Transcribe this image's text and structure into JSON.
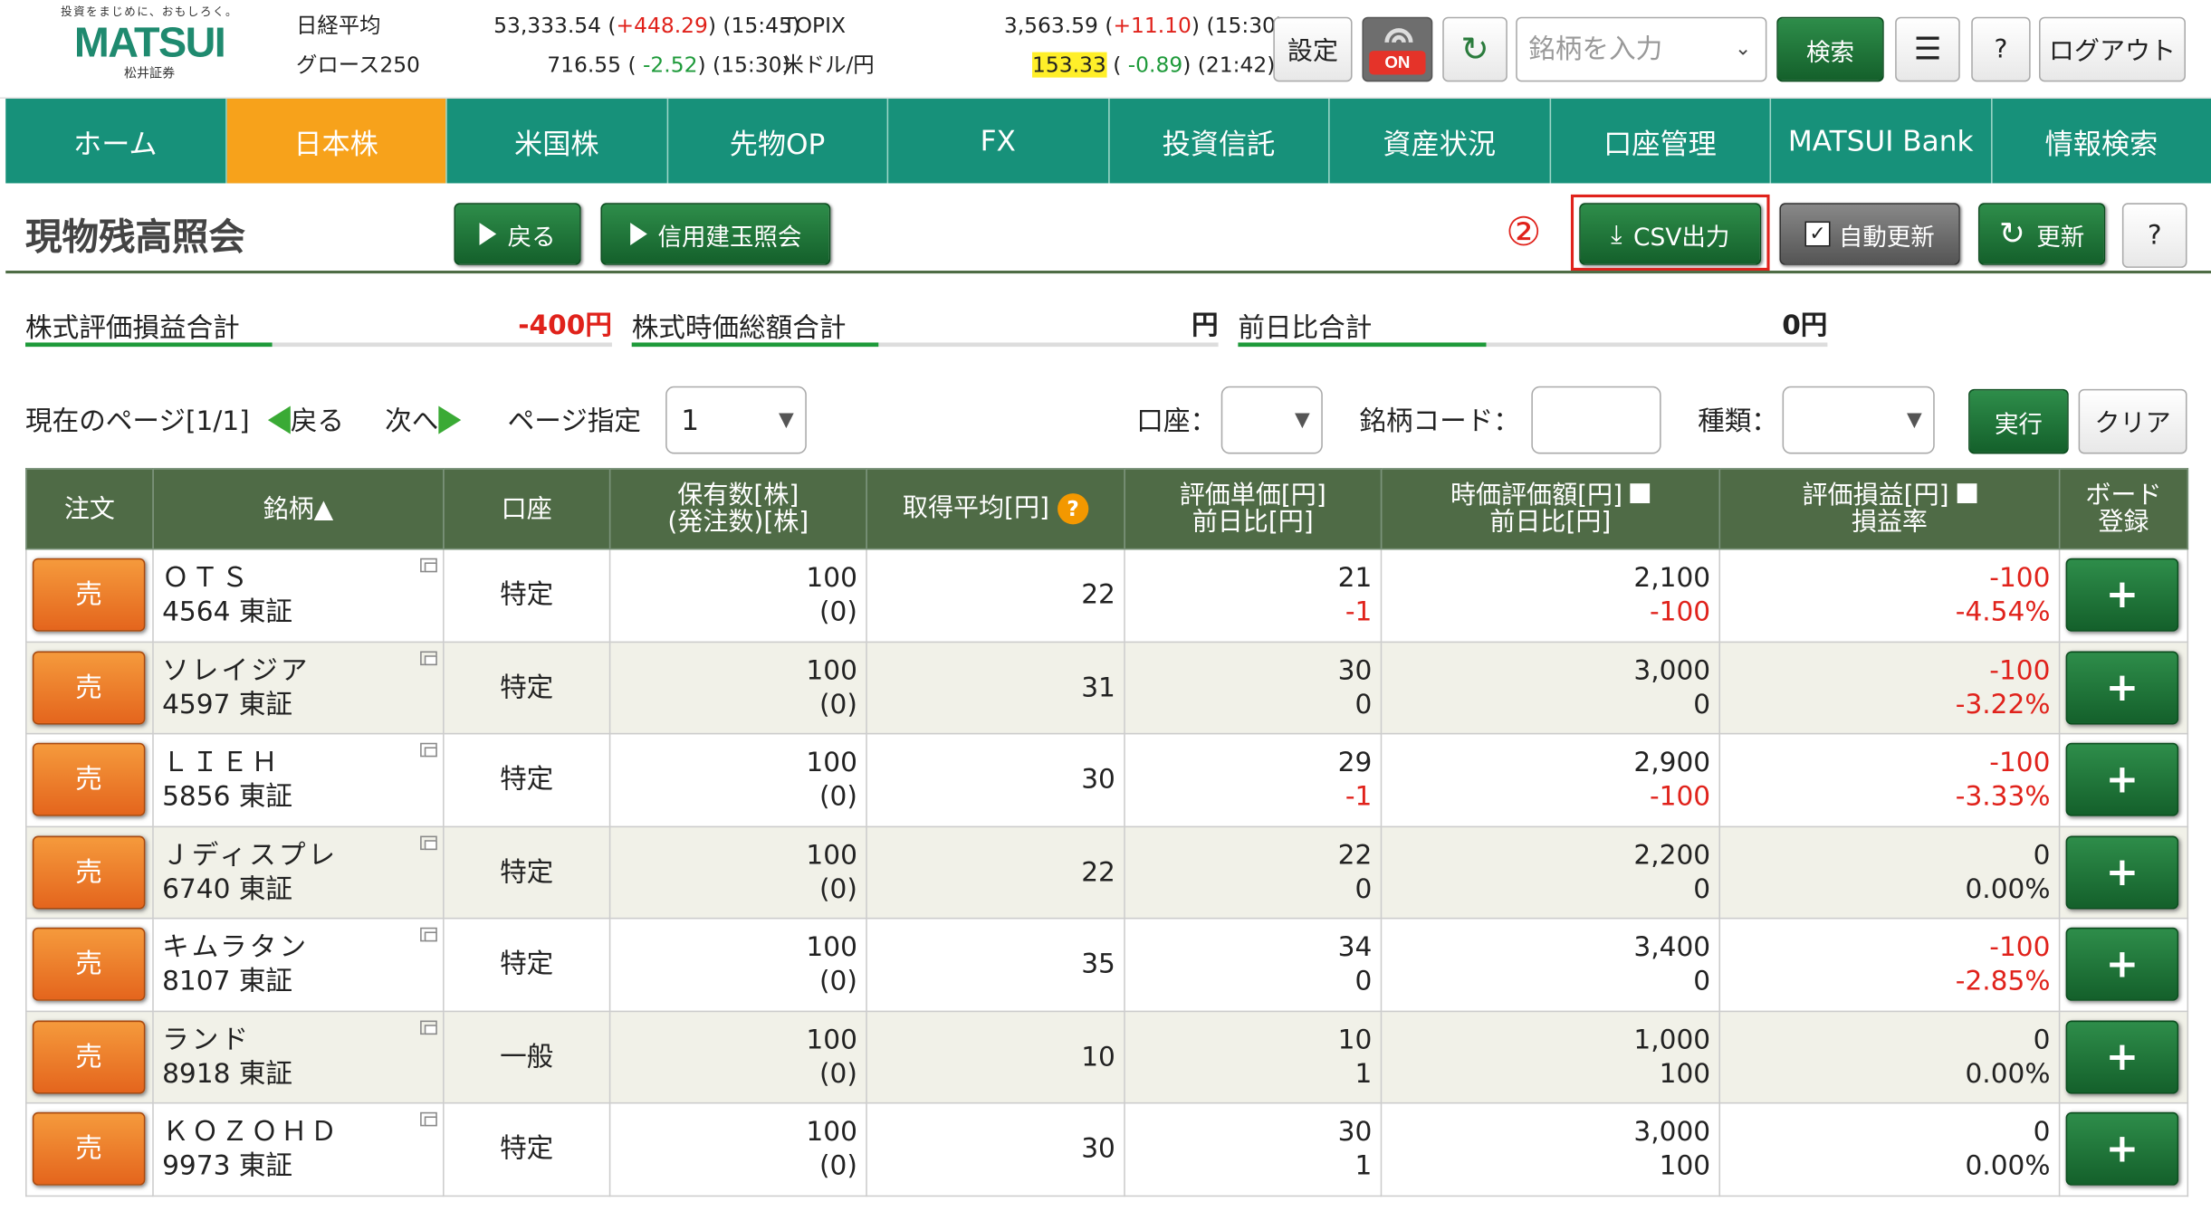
{
  "logo": {
    "tagline": "投資をまじめに、おもしろく。",
    "name": "MATSUI",
    "sub": "松井証券"
  },
  "market": {
    "nikkei": {
      "label": "日経平均",
      "value": "53,333.54",
      "open": " (",
      "change": "+448.29",
      "close": ")",
      "time": "(15:45)"
    },
    "topix": {
      "label": "TOPIX",
      "value": "3,563.59",
      "open": " (",
      "change": "+11.10",
      "close": ")",
      "time": "(15:30)"
    },
    "growth": {
      "label": "グロース250",
      "value": "716.55",
      "open": " ( ",
      "change": "-2.52",
      "close": ")",
      "time": "(15:30)"
    },
    "usdjpy": {
      "label": "米ドル/円",
      "value": "153.33",
      "open": " ( ",
      "change": "-0.89",
      "close": ")",
      "time": "(21:42)"
    }
  },
  "toolbar": {
    "settings": "設定",
    "wifi_status": "ON",
    "search_placeholder": "銘柄を入力",
    "search_button": "検索",
    "help": "?",
    "logout": "ログアウト"
  },
  "nav": [
    "ホーム",
    "日本株",
    "米国株",
    "先物OP",
    "FX",
    "投資信託",
    "資産状況",
    "口座管理",
    "MATSUI Bank",
    "情報検索"
  ],
  "nav_active": "日本株",
  "page": {
    "title": "現物残高照会",
    "back": "戻る",
    "margin": "信用建玉照会",
    "step": "②",
    "csv": "CSV出力",
    "auto_update": "自動更新",
    "refresh": "更新",
    "help": "?"
  },
  "summary": [
    {
      "label": "株式評価損益合計",
      "value": "-400円"
    },
    {
      "label": "株式時価総額合計",
      "value": "円"
    },
    {
      "label": "前日比合計",
      "value": "0円"
    }
  ],
  "pager": {
    "current": "現在のページ[1/1]",
    "prev": "戻る",
    "next": "次へ",
    "page_label": "ページ指定",
    "page_value": "1",
    "account_label": "口座：",
    "code_label": "銘柄コード：",
    "type_label": "種類：",
    "execute": "実行",
    "clear": "クリア"
  },
  "table": {
    "headers": {
      "order": "注文",
      "name": "銘柄▲",
      "account": "口座",
      "qty1": "保有数[株]",
      "qty2": "(発注数)[株]",
      "avg": "取得平均[円]",
      "avg_help": "?",
      "unit1": "評価単価[円]",
      "unit2": "前日比[円]",
      "mv1": "時価評価額[円]",
      "mv2": "前日比[円]",
      "pl1": "評価損益[円]",
      "pl2": "損益率",
      "board1": "ボード",
      "board2": "登録"
    },
    "sell_label": "売",
    "board_label": "+",
    "rows": [
      {
        "name": "ＯＴＳ",
        "code": "4564 東証",
        "account": "特定",
        "qty": "100",
        "pending": "(0)",
        "avg": "22",
        "price": "21",
        "price_chg": "-1",
        "value": "2,100",
        "value_chg": "-100",
        "pl": "-100",
        "pl_rate": "-4.54%"
      },
      {
        "name": "ソレイジア",
        "code": "4597 東証",
        "account": "特定",
        "qty": "100",
        "pending": "(0)",
        "avg": "31",
        "price": "30",
        "price_chg": "0",
        "value": "3,000",
        "value_chg": "0",
        "pl": "-100",
        "pl_rate": "-3.22%"
      },
      {
        "name": "ＬＩＥＨ",
        "code": "5856 東証",
        "account": "特定",
        "qty": "100",
        "pending": "(0)",
        "avg": "30",
        "price": "29",
        "price_chg": "-1",
        "value": "2,900",
        "value_chg": "-100",
        "pl": "-100",
        "pl_rate": "-3.33%"
      },
      {
        "name": "Ｊディスプレ",
        "code": "6740 東証",
        "account": "特定",
        "qty": "100",
        "pending": "(0)",
        "avg": "22",
        "price": "22",
        "price_chg": "0",
        "value": "2,200",
        "value_chg": "0",
        "pl": "0",
        "pl_rate": "0.00%"
      },
      {
        "name": "キムラタン",
        "code": "8107 東証",
        "account": "特定",
        "qty": "100",
        "pending": "(0)",
        "avg": "35",
        "price": "34",
        "price_chg": "0",
        "value": "3,400",
        "value_chg": "0",
        "pl": "-100",
        "pl_rate": "-2.85%"
      },
      {
        "name": "ランド",
        "code": "8918 東証",
        "account": "一般",
        "qty": "100",
        "pending": "(0)",
        "avg": "10",
        "price": "10",
        "price_chg": "1",
        "value": "1,000",
        "value_chg": "100",
        "pl": "0",
        "pl_rate": "0.00%"
      },
      {
        "name": "ＫＯＺＯＨＤ",
        "code": "9973 東証",
        "account": "特定",
        "qty": "100",
        "pending": "(0)",
        "avg": "30",
        "price": "30",
        "price_chg": "1",
        "value": "3,000",
        "value_chg": "100",
        "pl": "0",
        "pl_rate": "0.00%"
      }
    ]
  },
  "colors": {
    "nav_bg": "#17917a",
    "nav_active": "#f7a21b",
    "button_green": "#14602b",
    "sell_orange": "#e4651d",
    "loss_red": "#e0221b",
    "gain_green": "#1e9a3a",
    "header_bg": "#4f6b46"
  }
}
